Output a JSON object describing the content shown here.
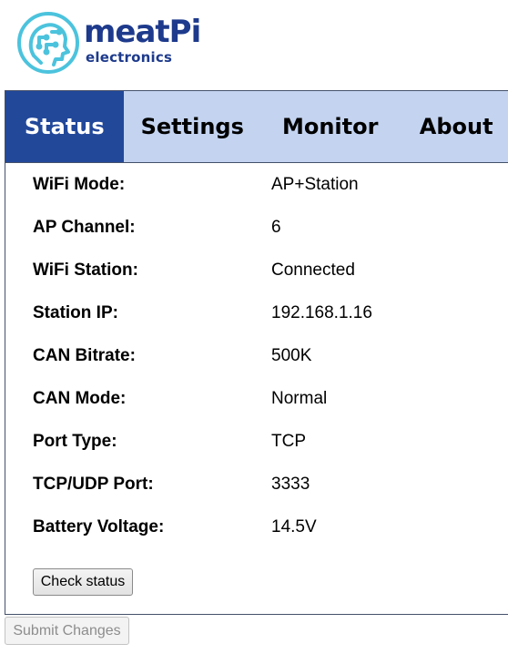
{
  "brand": {
    "name": "meatPi",
    "subtitle": "electronics",
    "color": "#1d3a8c",
    "mark_color": "#4cc3dd",
    "logo_icon": "circuit-head-icon"
  },
  "tabs": [
    {
      "label": "Status",
      "active": true
    },
    {
      "label": "Settings",
      "active": false
    },
    {
      "label": "Monitor",
      "active": false
    },
    {
      "label": "About",
      "active": false
    }
  ],
  "colors": {
    "tab_active_bg": "#22489a",
    "tab_bar_bg": "#c3d3f0"
  },
  "status": {
    "rows": [
      {
        "label": "WiFi Mode:",
        "value": "AP+Station"
      },
      {
        "label": "AP Channel:",
        "value": "6"
      },
      {
        "label": "WiFi Station:",
        "value": "Connected"
      },
      {
        "label": "Station IP:",
        "value": "192.168.1.16"
      },
      {
        "label": "CAN Bitrate:",
        "value": "500K"
      },
      {
        "label": "CAN Mode:",
        "value": "Normal"
      },
      {
        "label": "Port Type:",
        "value": "TCP"
      },
      {
        "label": "TCP/UDP Port:",
        "value": "3333"
      },
      {
        "label": "Battery Voltage:",
        "value": "14.5V"
      }
    ],
    "check_label": "Check status"
  },
  "footer": {
    "submit_label": "Submit Changes"
  }
}
